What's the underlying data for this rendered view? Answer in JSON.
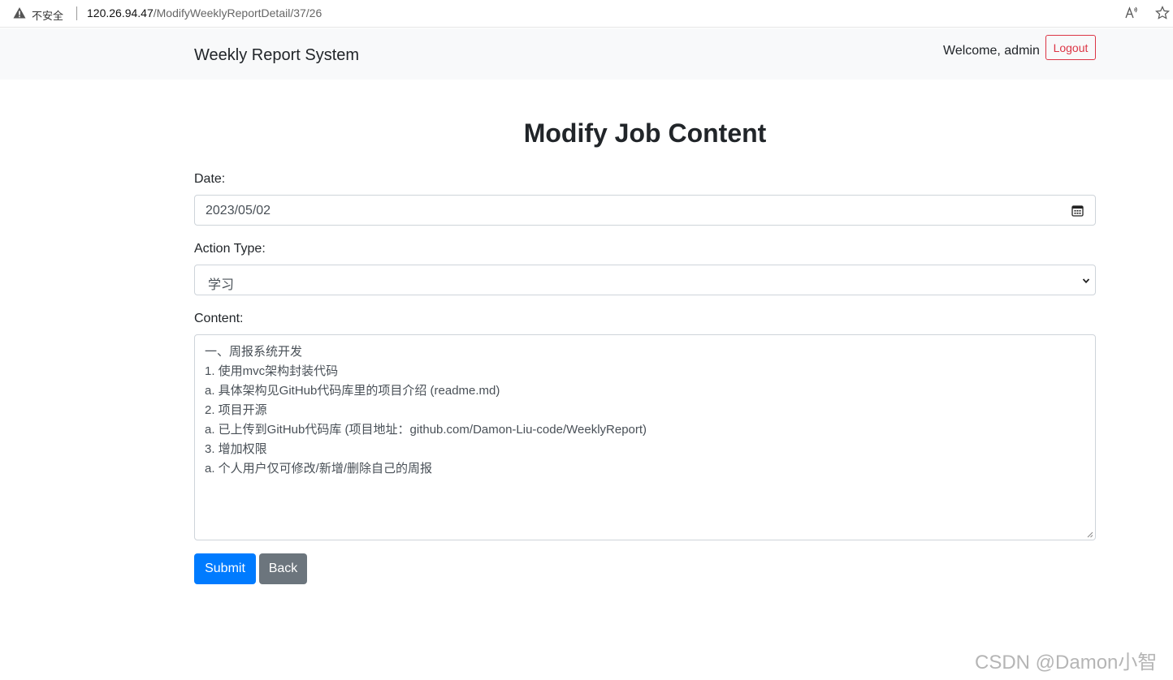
{
  "browser": {
    "insecure_label": "不安全",
    "url_host": "120.26.94.47",
    "url_path": "/ModifyWeeklyReportDetail/37/26"
  },
  "navbar": {
    "brand": "Weekly Report System",
    "welcome": "Welcome, admin",
    "logout_label": "Logout"
  },
  "form": {
    "title": "Modify Job Content",
    "date_label": "Date:",
    "date_value": "2023/05/02",
    "action_type_label": "Action Type:",
    "action_type_value": "学习",
    "content_label": "Content:",
    "content_lines": [
      "一、周报系统开发",
      "1. 使用mvc架构封装代码",
      "a. 具体架构见GitHub代码库里的项目介绍 (readme.md)",
      "2. 项目开源",
      "a. 已上传到GitHub代码库 (项目地址：github.com/Damon-Liu-code/WeeklyReport)",
      "3. 增加权限",
      "a. 个人用户仅可修改/新增/删除自己的周报"
    ],
    "submit_label": "Submit",
    "back_label": "Back"
  },
  "watermark": "CSDN @Damon小智",
  "colors": {
    "primary": "#007bff",
    "secondary": "#6c757d",
    "danger": "#dc3545",
    "navbar_bg": "#f8f9fa"
  },
  "icons": [
    "warning-icon",
    "read-aloud-icon",
    "favorite-icon",
    "calendar-icon",
    "chevron-down-icon"
  ]
}
